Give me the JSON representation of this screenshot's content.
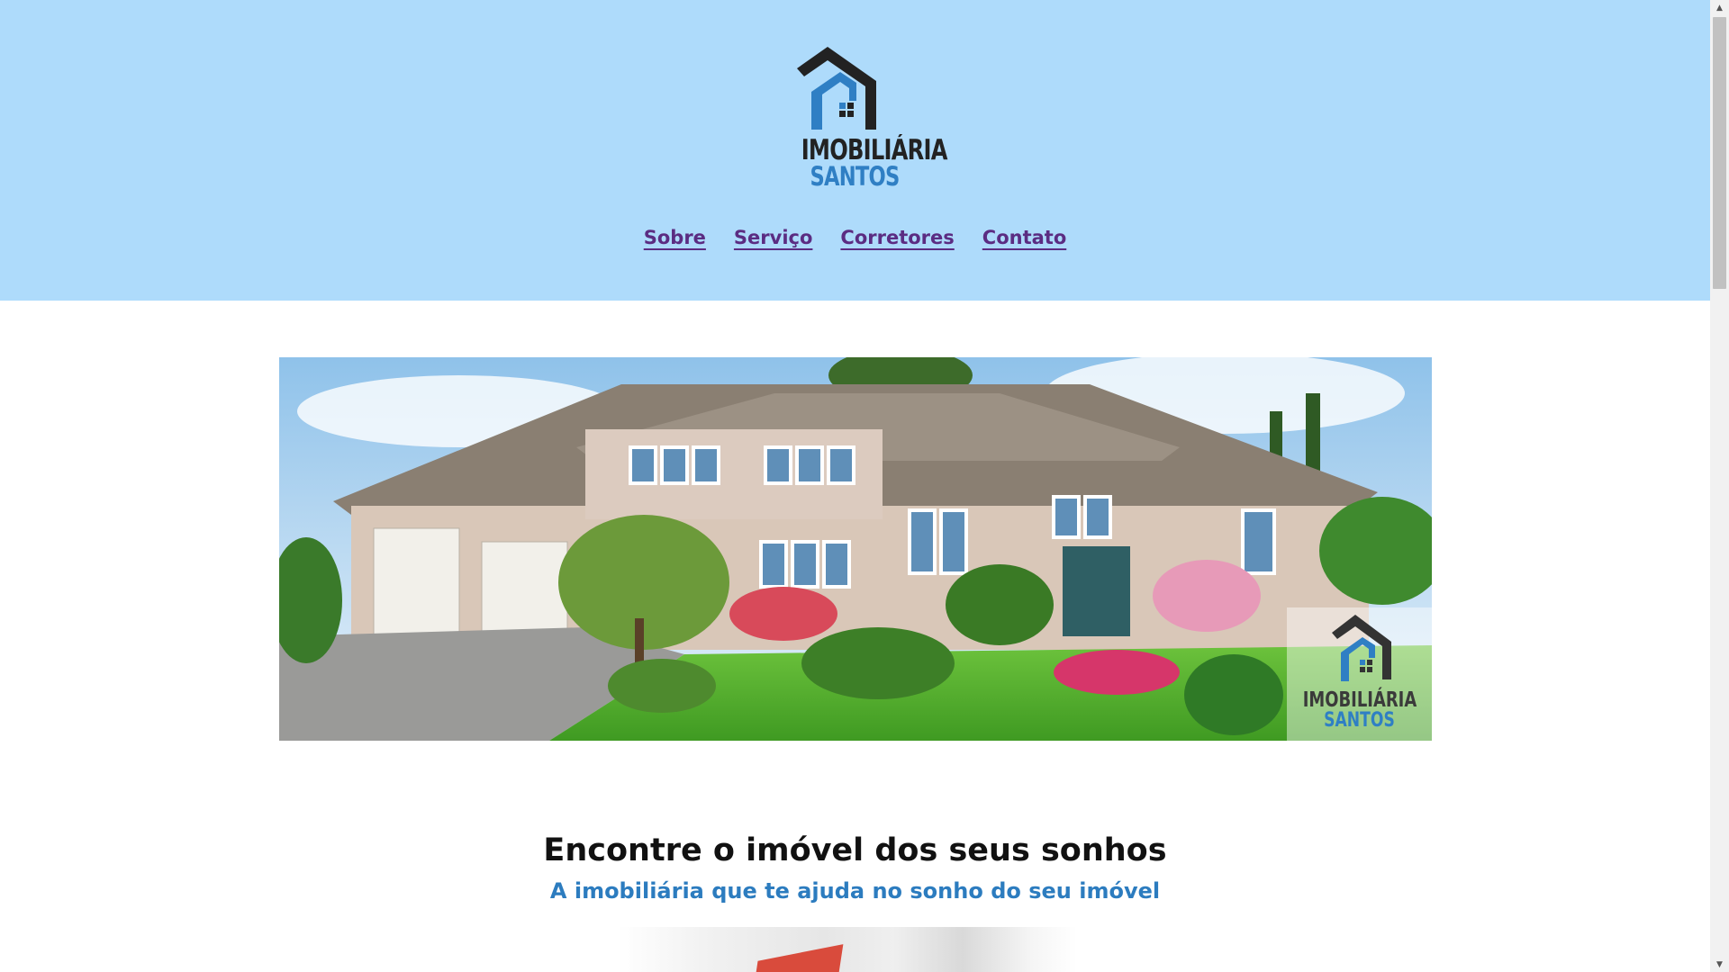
{
  "header": {
    "logo": {
      "line1": "IMOBILIÁRIA",
      "line2": "SANTOS",
      "icon": "house-logo-icon"
    },
    "nav": [
      {
        "label": "Sobre"
      },
      {
        "label": "Serviço"
      },
      {
        "label": "Corretores"
      },
      {
        "label": "Contato"
      }
    ]
  },
  "hero": {
    "image": "house-photo",
    "watermark": {
      "line1": "IMOBILIÁRIA",
      "line2": "SANTOS"
    }
  },
  "main": {
    "headline": "Encontre o imóvel dos seus sonhos",
    "subheadline": "A imobiliária que te ajuda no sonho do seu imóvel"
  },
  "colors": {
    "header_bg": "#aedbfb",
    "nav_link": "#5b2c82",
    "brand_blue": "#2f7fc4",
    "brand_dark": "#222222"
  }
}
